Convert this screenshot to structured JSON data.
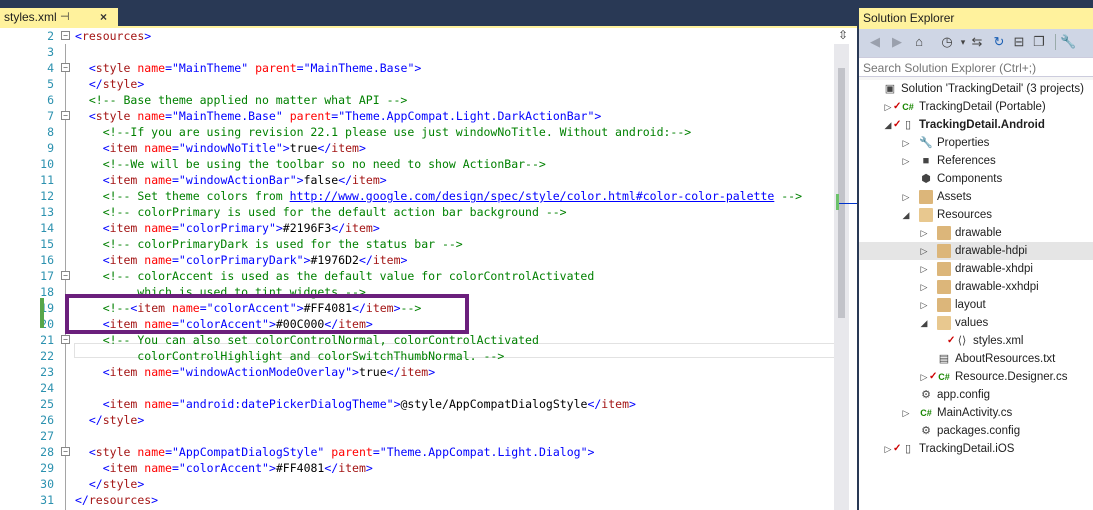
{
  "editor": {
    "tab_title": "styles.xml",
    "tab_pin": "⊣",
    "tab_close": "×",
    "lines": [
      {
        "n": "2",
        "segs": [
          [
            "t",
            "<"
          ],
          [
            "e",
            "resources"
          ],
          [
            "t",
            ">"
          ]
        ]
      },
      {
        "n": "3",
        "segs": []
      },
      {
        "n": "4",
        "segs": [
          [
            "p",
            "  "
          ],
          [
            "t",
            "<"
          ],
          [
            "e",
            "style"
          ],
          [
            "p",
            " "
          ],
          [
            "a",
            "name"
          ],
          [
            "t",
            "=\""
          ],
          [
            "v",
            "MainTheme"
          ],
          [
            "t",
            "\""
          ],
          [
            "p",
            " "
          ],
          [
            "a",
            "parent"
          ],
          [
            "t",
            "=\""
          ],
          [
            "v",
            "MainTheme.Base"
          ],
          [
            "t",
            "\">"
          ]
        ]
      },
      {
        "n": "5",
        "segs": [
          [
            "p",
            "  "
          ],
          [
            "t",
            "</"
          ],
          [
            "e",
            "style"
          ],
          [
            "t",
            ">"
          ]
        ]
      },
      {
        "n": "6",
        "segs": [
          [
            "p",
            "  "
          ],
          [
            "c",
            "<!-- Base theme applied no matter what API -->"
          ]
        ]
      },
      {
        "n": "7",
        "segs": [
          [
            "p",
            "  "
          ],
          [
            "t",
            "<"
          ],
          [
            "e",
            "style"
          ],
          [
            "p",
            " "
          ],
          [
            "a",
            "name"
          ],
          [
            "t",
            "=\""
          ],
          [
            "v",
            "MainTheme.Base"
          ],
          [
            "t",
            "\""
          ],
          [
            "p",
            " "
          ],
          [
            "a",
            "parent"
          ],
          [
            "t",
            "=\""
          ],
          [
            "v",
            "Theme.AppCompat.Light.DarkActionBar"
          ],
          [
            "t",
            "\">"
          ]
        ]
      },
      {
        "n": "8",
        "segs": [
          [
            "p",
            "    "
          ],
          [
            "c",
            "<!--If you are using revision 22.1 please use just windowNoTitle. Without android:-->"
          ]
        ]
      },
      {
        "n": "9",
        "segs": [
          [
            "p",
            "    "
          ],
          [
            "t",
            "<"
          ],
          [
            "e",
            "item"
          ],
          [
            "p",
            " "
          ],
          [
            "a",
            "name"
          ],
          [
            "t",
            "=\""
          ],
          [
            "v",
            "windowNoTitle"
          ],
          [
            "t",
            "\">"
          ],
          [
            "x",
            "true"
          ],
          [
            "t",
            "</"
          ],
          [
            "e",
            "item"
          ],
          [
            "t",
            ">"
          ]
        ]
      },
      {
        "n": "10",
        "segs": [
          [
            "p",
            "    "
          ],
          [
            "c",
            "<!--We will be using the toolbar so no need to show ActionBar-->"
          ]
        ]
      },
      {
        "n": "11",
        "segs": [
          [
            "p",
            "    "
          ],
          [
            "t",
            "<"
          ],
          [
            "e",
            "item"
          ],
          [
            "p",
            " "
          ],
          [
            "a",
            "name"
          ],
          [
            "t",
            "=\""
          ],
          [
            "v",
            "windowActionBar"
          ],
          [
            "t",
            "\">"
          ],
          [
            "x",
            "false"
          ],
          [
            "t",
            "</"
          ],
          [
            "e",
            "item"
          ],
          [
            "t",
            ">"
          ]
        ]
      },
      {
        "n": "12",
        "segs": [
          [
            "p",
            "    "
          ],
          [
            "c",
            "<!-- Set theme colors from "
          ],
          [
            "l",
            "http://www.google.com/design/spec/style/color.html#color-color-palette"
          ],
          [
            "c",
            " -->"
          ]
        ]
      },
      {
        "n": "13",
        "segs": [
          [
            "p",
            "    "
          ],
          [
            "c",
            "<!-- colorPrimary is used for the default action bar background -->"
          ]
        ]
      },
      {
        "n": "14",
        "segs": [
          [
            "p",
            "    "
          ],
          [
            "t",
            "<"
          ],
          [
            "e",
            "item"
          ],
          [
            "p",
            " "
          ],
          [
            "a",
            "name"
          ],
          [
            "t",
            "=\""
          ],
          [
            "v",
            "colorPrimary"
          ],
          [
            "t",
            "\">"
          ],
          [
            "x",
            "#2196F3"
          ],
          [
            "t",
            "</"
          ],
          [
            "e",
            "item"
          ],
          [
            "t",
            ">"
          ]
        ]
      },
      {
        "n": "15",
        "segs": [
          [
            "p",
            "    "
          ],
          [
            "c",
            "<!-- colorPrimaryDark is used for the status bar -->"
          ]
        ]
      },
      {
        "n": "16",
        "segs": [
          [
            "p",
            "    "
          ],
          [
            "t",
            "<"
          ],
          [
            "e",
            "item"
          ],
          [
            "p",
            " "
          ],
          [
            "a",
            "name"
          ],
          [
            "t",
            "=\""
          ],
          [
            "v",
            "colorPrimaryDark"
          ],
          [
            "t",
            "\">"
          ],
          [
            "x",
            "#1976D2"
          ],
          [
            "t",
            "</"
          ],
          [
            "e",
            "item"
          ],
          [
            "t",
            ">"
          ]
        ]
      },
      {
        "n": "17",
        "segs": [
          [
            "p",
            "    "
          ],
          [
            "c",
            "<!-- colorAccent is used as the default value for colorControlActivated"
          ]
        ]
      },
      {
        "n": "18",
        "segs": [
          [
            "c",
            "         which is used to tint widgets -->"
          ]
        ]
      },
      {
        "n": "19",
        "segs": [
          [
            "p",
            "    "
          ],
          [
            "c",
            "<!--"
          ],
          [
            "t",
            "<"
          ],
          [
            "e",
            "item"
          ],
          [
            "p",
            " "
          ],
          [
            "a",
            "name"
          ],
          [
            "t",
            "=\""
          ],
          [
            "v",
            "colorAccent"
          ],
          [
            "t",
            "\">"
          ],
          [
            "x",
            "#FF4081"
          ],
          [
            "t",
            "</"
          ],
          [
            "e",
            "item"
          ],
          [
            "t",
            ">"
          ],
          [
            "c",
            "-->"
          ]
        ]
      },
      {
        "n": "20",
        "segs": [
          [
            "p",
            "    "
          ],
          [
            "t",
            "<"
          ],
          [
            "e",
            "item"
          ],
          [
            "p",
            " "
          ],
          [
            "a",
            "name"
          ],
          [
            "t",
            "=\""
          ],
          [
            "v",
            "colorAccent"
          ],
          [
            "t",
            "\">"
          ],
          [
            "x",
            "#00C000"
          ],
          [
            "t",
            "</"
          ],
          [
            "e",
            "item"
          ],
          [
            "t",
            ">"
          ]
        ]
      },
      {
        "n": "21",
        "segs": [
          [
            "p",
            "    "
          ],
          [
            "c",
            "<!-- You can also set colorControlNormal, colorControlActivated"
          ]
        ]
      },
      {
        "n": "22",
        "segs": [
          [
            "c",
            "         colorControlHighlight and colorSwitchThumbNormal. -->"
          ]
        ]
      },
      {
        "n": "23",
        "segs": [
          [
            "p",
            "    "
          ],
          [
            "t",
            "<"
          ],
          [
            "e",
            "item"
          ],
          [
            "p",
            " "
          ],
          [
            "a",
            "name"
          ],
          [
            "t",
            "=\""
          ],
          [
            "v",
            "windowActionModeOverlay"
          ],
          [
            "t",
            "\">"
          ],
          [
            "x",
            "true"
          ],
          [
            "t",
            "</"
          ],
          [
            "e",
            "item"
          ],
          [
            "t",
            ">"
          ]
        ]
      },
      {
        "n": "24",
        "segs": []
      },
      {
        "n": "25",
        "segs": [
          [
            "p",
            "    "
          ],
          [
            "t",
            "<"
          ],
          [
            "e",
            "item"
          ],
          [
            "p",
            " "
          ],
          [
            "a",
            "name"
          ],
          [
            "t",
            "=\""
          ],
          [
            "v",
            "android:datePickerDialogTheme"
          ],
          [
            "t",
            "\">"
          ],
          [
            "x",
            "@style/AppCompatDialogStyle"
          ],
          [
            "t",
            "</"
          ],
          [
            "e",
            "item"
          ],
          [
            "t",
            ">"
          ]
        ]
      },
      {
        "n": "26",
        "segs": [
          [
            "p",
            "  "
          ],
          [
            "t",
            "</"
          ],
          [
            "e",
            "style"
          ],
          [
            "t",
            ">"
          ]
        ]
      },
      {
        "n": "27",
        "segs": []
      },
      {
        "n": "28",
        "segs": [
          [
            "p",
            "  "
          ],
          [
            "t",
            "<"
          ],
          [
            "e",
            "style"
          ],
          [
            "p",
            " "
          ],
          [
            "a",
            "name"
          ],
          [
            "t",
            "=\""
          ],
          [
            "v",
            "AppCompatDialogStyle"
          ],
          [
            "t",
            "\""
          ],
          [
            "p",
            " "
          ],
          [
            "a",
            "parent"
          ],
          [
            "t",
            "=\""
          ],
          [
            "v",
            "Theme.AppCompat.Light.Dialog"
          ],
          [
            "t",
            "\">"
          ]
        ]
      },
      {
        "n": "29",
        "segs": [
          [
            "p",
            "    "
          ],
          [
            "t",
            "<"
          ],
          [
            "e",
            "item"
          ],
          [
            "p",
            " "
          ],
          [
            "a",
            "name"
          ],
          [
            "t",
            "=\""
          ],
          [
            "v",
            "colorAccent"
          ],
          [
            "t",
            "\">"
          ],
          [
            "x",
            "#FF4081"
          ],
          [
            "t",
            "</"
          ],
          [
            "e",
            "item"
          ],
          [
            "t",
            ">"
          ]
        ]
      },
      {
        "n": "30",
        "segs": [
          [
            "p",
            "  "
          ],
          [
            "t",
            "</"
          ],
          [
            "e",
            "style"
          ],
          [
            "t",
            ">"
          ]
        ]
      },
      {
        "n": "31",
        "segs": [
          [
            "t",
            "</"
          ],
          [
            "e",
            "resources"
          ],
          [
            "t",
            ">"
          ]
        ]
      }
    ],
    "folds": [
      "2",
      "4",
      "7",
      "17",
      "21",
      "28"
    ],
    "colors": {
      "tag": "#0000ff",
      "element": "#a31515",
      "attribute": "#ff0000",
      "value": "#0000ff",
      "comment": "#008000",
      "text": "#000000",
      "line_number": "#2b91af",
      "highlight_box": "#6b1f7c",
      "change_bar": "#57a64a"
    }
  },
  "solution_explorer": {
    "title": "Solution Explorer",
    "search_placeholder": "Search Solution Explorer (Ctrl+;)",
    "toolbar_icons": [
      "back-icon",
      "forward-icon",
      "home-icon",
      "history-icon",
      "sync-icon",
      "refresh-icon",
      "collapse-all-icon",
      "copy-icon",
      "properties-wrench-icon"
    ],
    "tree": [
      {
        "label": "Solution 'TrackingDetail' (3 projects)",
        "indent": 0,
        "arrow": "",
        "icon": "solution-icon",
        "check": false
      },
      {
        "label": "TrackingDetail (Portable)",
        "indent": 1,
        "arrow": "▷",
        "icon": "csharp-project-icon",
        "check": true
      },
      {
        "label": "TrackingDetail.Android",
        "indent": 1,
        "arrow": "◢",
        "icon": "android-project-icon",
        "check": true,
        "bold": true
      },
      {
        "label": "Properties",
        "indent": 2,
        "arrow": "▷",
        "icon": "wrench-icon",
        "check": false
      },
      {
        "label": "References",
        "indent": 2,
        "arrow": "▷",
        "icon": "references-icon",
        "check": false
      },
      {
        "label": "Components",
        "indent": 2,
        "arrow": "",
        "icon": "components-icon",
        "check": false
      },
      {
        "label": "Assets",
        "indent": 2,
        "arrow": "▷",
        "icon": "folder-icon",
        "check": false
      },
      {
        "label": "Resources",
        "indent": 2,
        "arrow": "◢",
        "icon": "folder-open-icon",
        "check": false
      },
      {
        "label": "drawable",
        "indent": 3,
        "arrow": "▷",
        "icon": "folder-icon",
        "check": false
      },
      {
        "label": "drawable-hdpi",
        "indent": 3,
        "arrow": "▷",
        "icon": "folder-icon",
        "check": false,
        "selected": true
      },
      {
        "label": "drawable-xhdpi",
        "indent": 3,
        "arrow": "▷",
        "icon": "folder-icon",
        "check": false
      },
      {
        "label": "drawable-xxhdpi",
        "indent": 3,
        "arrow": "▷",
        "icon": "folder-icon",
        "check": false
      },
      {
        "label": "layout",
        "indent": 3,
        "arrow": "▷",
        "icon": "folder-icon",
        "check": false
      },
      {
        "label": "values",
        "indent": 3,
        "arrow": "◢",
        "icon": "folder-open-icon",
        "check": false
      },
      {
        "label": "styles.xml",
        "indent": 4,
        "arrow": "",
        "icon": "xml-file-icon",
        "check": true
      },
      {
        "label": "AboutResources.txt",
        "indent": 3,
        "arrow": "",
        "icon": "text-file-icon",
        "check": false
      },
      {
        "label": "Resource.Designer.cs",
        "indent": 3,
        "arrow": "▷",
        "icon": "csharp-file-icon",
        "check": true
      },
      {
        "label": "app.config",
        "indent": 2,
        "arrow": "",
        "icon": "config-file-icon",
        "check": false
      },
      {
        "label": "MainActivity.cs",
        "indent": 2,
        "arrow": "▷",
        "icon": "csharp-file-icon",
        "check": false
      },
      {
        "label": "packages.config",
        "indent": 2,
        "arrow": "",
        "icon": "config-file-icon",
        "check": false
      },
      {
        "label": "TrackingDetail.iOS",
        "indent": 1,
        "arrow": "▷",
        "icon": "ios-project-icon",
        "check": true
      }
    ]
  }
}
